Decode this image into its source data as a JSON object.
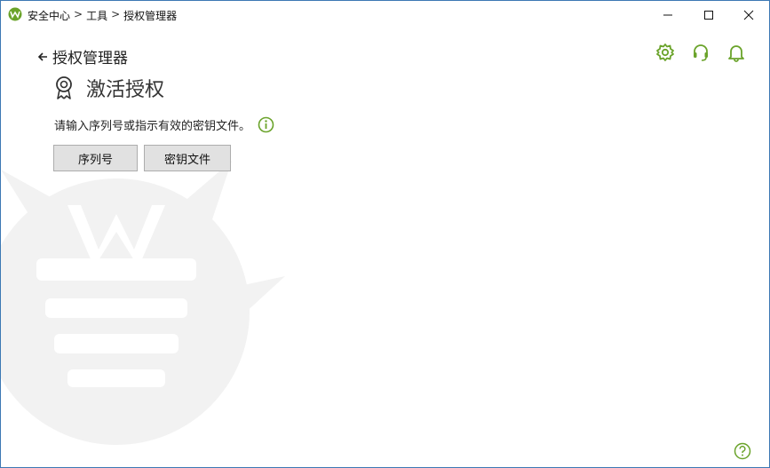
{
  "colors": {
    "accent": "#6aa32a",
    "window_border": "#3c78b4"
  },
  "titlebar": {
    "breadcrumb": [
      "安全中心",
      "工具",
      "授权管理器"
    ],
    "separator": ">",
    "logo_icon": "dr-web-spider-icon",
    "controls": [
      "minimize-icon",
      "maximize-icon",
      "close-icon"
    ]
  },
  "nav": {
    "back_label": "授权管理器",
    "back_icon": "arrow-left-icon"
  },
  "header_icons": [
    "gear-icon",
    "headset-icon",
    "bell-icon"
  ],
  "page": {
    "title": "激活授权",
    "title_icon": "award-ribbon-icon",
    "instruction": "请输入序列号或指示有效的密钥文件。",
    "info_icon": "info-icon"
  },
  "buttons": {
    "serial": "序列号",
    "key_file": "密钥文件"
  },
  "footer": {
    "help_icon": "question-icon"
  }
}
